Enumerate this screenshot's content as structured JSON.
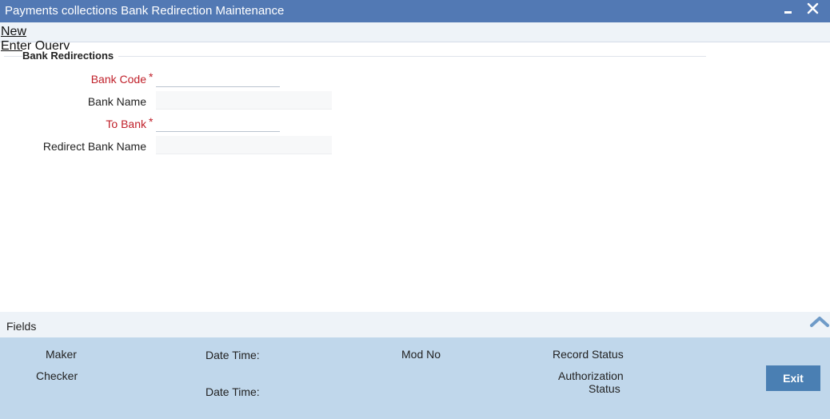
{
  "window": {
    "title": "Payments collections Bank Redirection Maintenance",
    "minimize_icon": "minimize-icon",
    "close_icon": "close-icon"
  },
  "toolbar": {
    "new_label": "New",
    "enter_query_label": "Enter Query"
  },
  "section": {
    "title": "Bank Redirections"
  },
  "form": {
    "bank_code": {
      "label": "Bank Code",
      "required_mark": "*",
      "value": ""
    },
    "bank_name": {
      "label": "Bank Name",
      "value": ""
    },
    "to_bank": {
      "label": "To Bank",
      "required_mark": "*",
      "value": ""
    },
    "redirect_bank_name": {
      "label": "Redirect Bank Name",
      "value": ""
    }
  },
  "fields_bar": {
    "label": "Fields",
    "toggle_icon": "chevron-up-icon"
  },
  "footer": {
    "maker": "Maker",
    "checker": "Checker",
    "date_time_1": "Date Time:",
    "date_time_2": "Date Time:",
    "mod_no": "Mod No",
    "record_status": "Record Status",
    "authorization": "Authorization",
    "status": "Status",
    "exit_label": "Exit"
  },
  "colors": {
    "titlebar": "#5279b4",
    "required_label": "#c0202a",
    "footer_bg": "#c0d7eb",
    "exit_button": "#4a7fb3"
  }
}
